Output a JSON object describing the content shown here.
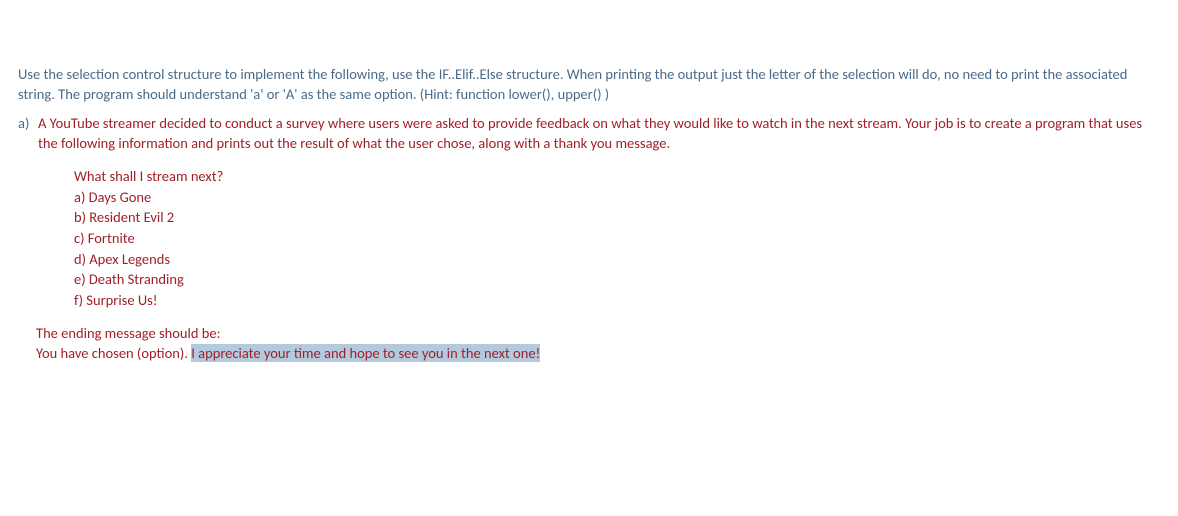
{
  "intro": "Use the selection control structure to implement the following, use the IF..Elif..Else structure. When printing the output just the letter of the selection will do, no need to print the associated string. The program should understand 'a' or 'A' as the same option. (Hint: function lower(), upper() )",
  "item": {
    "marker": "a)",
    "body": "A YouTube streamer decided to conduct a survey where users were asked to provide feedback on what they would like to watch in the next stream. Your job is to create a program that uses the following information and prints out the result of what the user chose, along with a thank you message."
  },
  "options": {
    "prompt": "What shall I stream next?",
    "a": "a) Days Gone",
    "b": "b) Resident Evil 2",
    "c": "c) Fortnite",
    "d": "d) Apex Legends",
    "e": "e) Death Stranding",
    "f": "f) Surprise Us!"
  },
  "ending": {
    "label": "The ending message should be:",
    "prefix": "You have chosen (option). ",
    "highlighted": "I appreciate your time and hope to see you in the next one!"
  }
}
